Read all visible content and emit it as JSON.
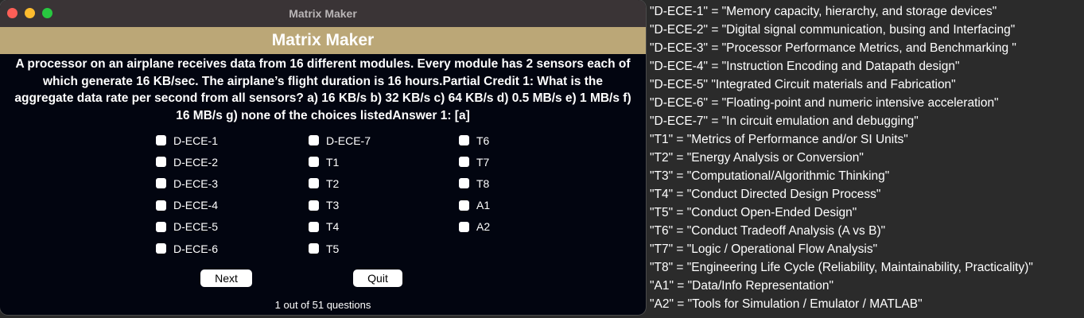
{
  "window": {
    "title": "Matrix Maker"
  },
  "banner": {
    "title": "Matrix Maker"
  },
  "question": {
    "text": "A processor on an airplane receives data from 16 different modules. Every module has 2 sensors each of which generate 16 KB/sec. The airplane’s flight duration is 16 hours.Partial Credit 1: What is the aggregate data rate per second from all sensors? a) 16 KB/s b) 32 KB/s c) 64 KB/s d) 0.5 MB/s e) 1 MB/s f) 16 MB/s g) none of the choices listedAnswer 1: [a]"
  },
  "checkboxes": {
    "col1": [
      "D-ECE-1",
      "D-ECE-2",
      "D-ECE-3",
      "D-ECE-4",
      "D-ECE-5",
      "D-ECE-6"
    ],
    "col2": [
      "D-ECE-7",
      "T1",
      "T2",
      "T3",
      "T4",
      "T5"
    ],
    "col3": [
      "T6",
      "T7",
      "T8",
      "A1",
      "A2"
    ]
  },
  "buttons": {
    "next": "Next",
    "quit": "Quit"
  },
  "progress": "1 out of 51 questions",
  "legend": [
    "\"D-ECE-1\" = \"Memory capacity, hierarchy, and storage devices\"",
    "\"D-ECE-2\" = \"Digital signal communication, busing and Interfacing\"",
    "\"D-ECE-3\" = \"Processor Performance Metrics, and Benchmarking \"",
    "\"D-ECE-4\" = \"Instruction Encoding and Datapath design\"",
    "\"D-ECE-5\" \"Integrated Circuit materials and Fabrication\"",
    "\"D-ECE-6\" = \"Floating-point and numeric intensive acceleration\"",
    "\"D-ECE-7\" = \"In circuit emulation and debugging\"",
    "\"T1\" = \"Metrics of Performance and/or SI Units\"",
    "\"T2\" = \"Energy Analysis or Conversion\"",
    "\"T3\" = \"Computational/Algorithmic Thinking\"",
    "\"T4\" = \"Conduct Directed Design Process\"",
    "\"T5\" = \"Conduct Open-Ended Design\"",
    "\"T6\" = \"Conduct Tradeoff Analysis (A vs B)\"",
    "\"T7\" = \"Logic / Operational Flow Analysis\"",
    "\"T8\" = \"Engineering Life Cycle (Reliability, Maintainability, Practicality)\"",
    "\"A1\" = \"Data/Info Representation\"",
    "\"A2\" = \"Tools for Simulation / Emulator / MATLAB\""
  ]
}
